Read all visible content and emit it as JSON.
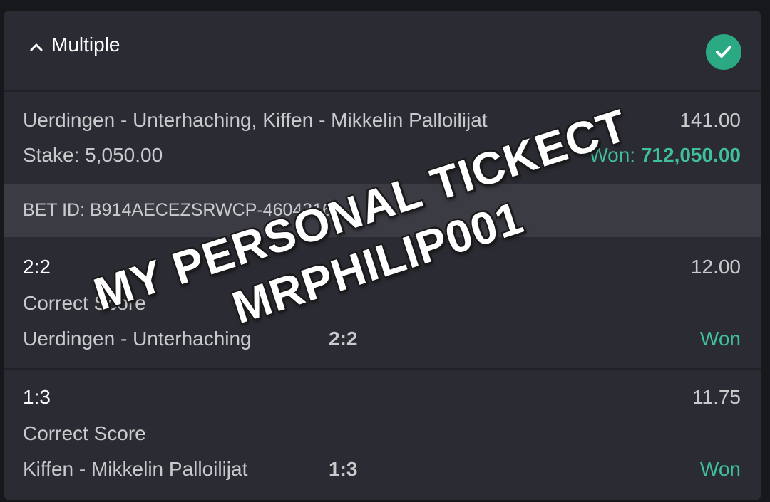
{
  "header": {
    "title": "Multiple",
    "collapse_icon": "chevron-up-icon",
    "status_icon": "check-circle-icon"
  },
  "summary": {
    "events": "Uerdingen - Unterhaching, Kiffen - Mikkelin Palloilijat",
    "total_odds": "141.00",
    "stake": "Stake: 5,050.00",
    "won_label": "Won: ",
    "won_amount": "712,050.00"
  },
  "bet_id": "BET ID: B914AECEZSRWCP-4604316",
  "selections": [
    {
      "score": "2:2",
      "odds": "12.00",
      "market": "Correct Score",
      "match": "Uerdingen - Unterhaching",
      "pick": "2:2",
      "status": "Won"
    },
    {
      "score": "1:3",
      "odds": "11.75",
      "market": "Correct Score",
      "match": "Kiffen - Mikkelin Palloilijat",
      "pick": "1:3",
      "status": "Won"
    }
  ],
  "watermark": {
    "line1": "MY PERSONAL TICKECT",
    "line2": "MRPHILIP001"
  },
  "colors": {
    "background": "#17181c",
    "card": "#2b2c33",
    "bet_id_row": "#3a3b43",
    "accent_green": "#3fbf9a",
    "check_green": "#2aa983"
  }
}
